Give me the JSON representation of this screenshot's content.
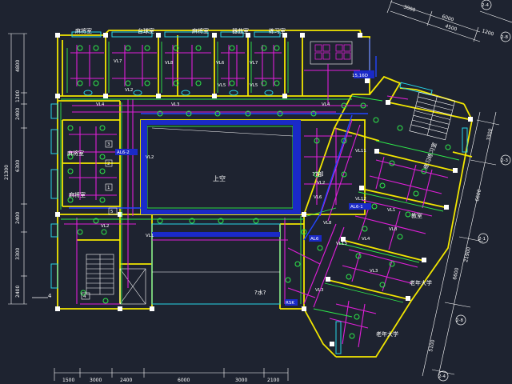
{
  "rooms": {
    "top": [
      "麻将室",
      "台球室",
      "麻将室",
      "器曲室",
      "练习室"
    ],
    "left_upper": "麻将室",
    "left_lower": "麻将室",
    "center": "上空",
    "center_right": "??部",
    "right_upper": "练习练习室",
    "right_mid": "教室",
    "right_lower": "老年大学",
    "right_bottom": "老年大学",
    "lower_right_small": "?水?"
  },
  "panels": {
    "al6_2": "AL6-2",
    "al6_1": "AL6-1",
    "al6": "AL6",
    "v1": "1",
    "v2": "2",
    "v3": "3",
    "v4": "4",
    "v5": "5",
    "sb": "15,16D",
    "rsk": "RSK"
  },
  "lines": {
    "vl1": "VL1",
    "vl2": "VL2",
    "vl3": "VL3",
    "vl4": "VL4",
    "vl5": "VL5",
    "vl6": "VL6",
    "vl7": "VL7",
    "vl8": "VL8",
    "vl11": "VL11",
    "vl12": "VL12",
    "vl13": "VL13"
  },
  "dims": {
    "left": [
      "4800",
      "1200",
      "2400",
      "6300",
      "21300",
      "2400",
      "3300",
      "2400"
    ],
    "bottom": [
      "1500",
      "3000",
      "2400",
      "6000",
      "3000",
      "2100"
    ],
    "top_right": [
      "3000",
      "6000",
      "4500",
      "1200"
    ],
    "right": [
      "3300",
      "6600",
      "21900",
      "6600",
      "5100"
    ]
  },
  "axes": {
    "top_right_a": "2-4",
    "top_right_b": "2-8",
    "right_1": "2-3",
    "right_2": "2-1",
    "right_3": "2-8",
    "bottom_right": "2-4",
    "left_marker": "4"
  }
}
